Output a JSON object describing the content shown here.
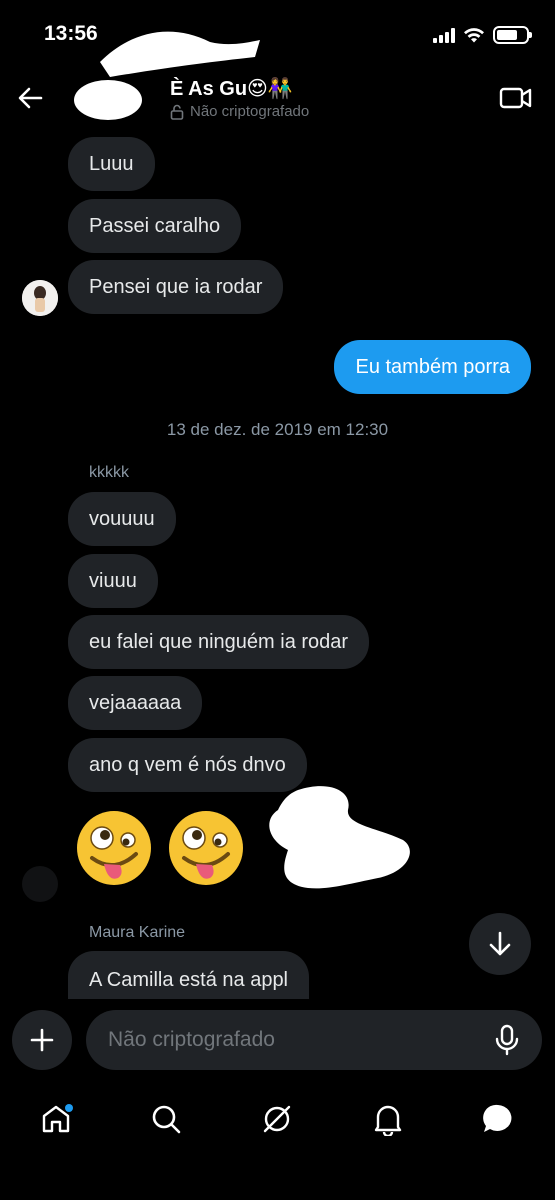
{
  "status_bar": {
    "time": "13:56",
    "battery_level": 0.7
  },
  "header": {
    "title": "È As Gu😍👫",
    "subtitle": "Não criptografado"
  },
  "messages": [
    {
      "text": "Luuu",
      "direction": "in"
    },
    {
      "text": "Passei caralho",
      "direction": "in"
    },
    {
      "text": "Pensei que ia rodar",
      "direction": "in"
    },
    {
      "text": "Eu também porra",
      "direction": "out"
    },
    {
      "text": "vouuuu",
      "direction": "in"
    },
    {
      "text": "viuuu",
      "direction": "in"
    },
    {
      "text": "eu falei que ninguém ia rodar",
      "direction": "in"
    },
    {
      "text": "vejaaaaaa",
      "direction": "in"
    },
    {
      "text": "ano q vem é nós dnvo",
      "direction": "in"
    },
    {
      "text": "🤪",
      "direction": "in"
    },
    {
      "text": "🤪",
      "direction": "in"
    },
    {
      "text": "A Camilla está na appl",
      "direction": "in"
    }
  ],
  "timestamp": "13 de dez. de 2019 em 12:30",
  "senders": {
    "first": "kkkkk",
    "second": "Maura Karine"
  },
  "composer": {
    "placeholder": "Não criptografado"
  },
  "icons": {
    "back": "back-arrow-icon",
    "video": "video-call-icon",
    "lock": "lock-icon",
    "scroll": "arrow-down-icon",
    "add": "plus-icon",
    "mic": "microphone-icon",
    "tabs": [
      "home-icon",
      "search-icon",
      "grok-icon",
      "notifications-icon",
      "messages-icon"
    ]
  },
  "colors": {
    "accent": "#1d9bf0",
    "bubble_in": "#202327",
    "background": "#000000"
  }
}
